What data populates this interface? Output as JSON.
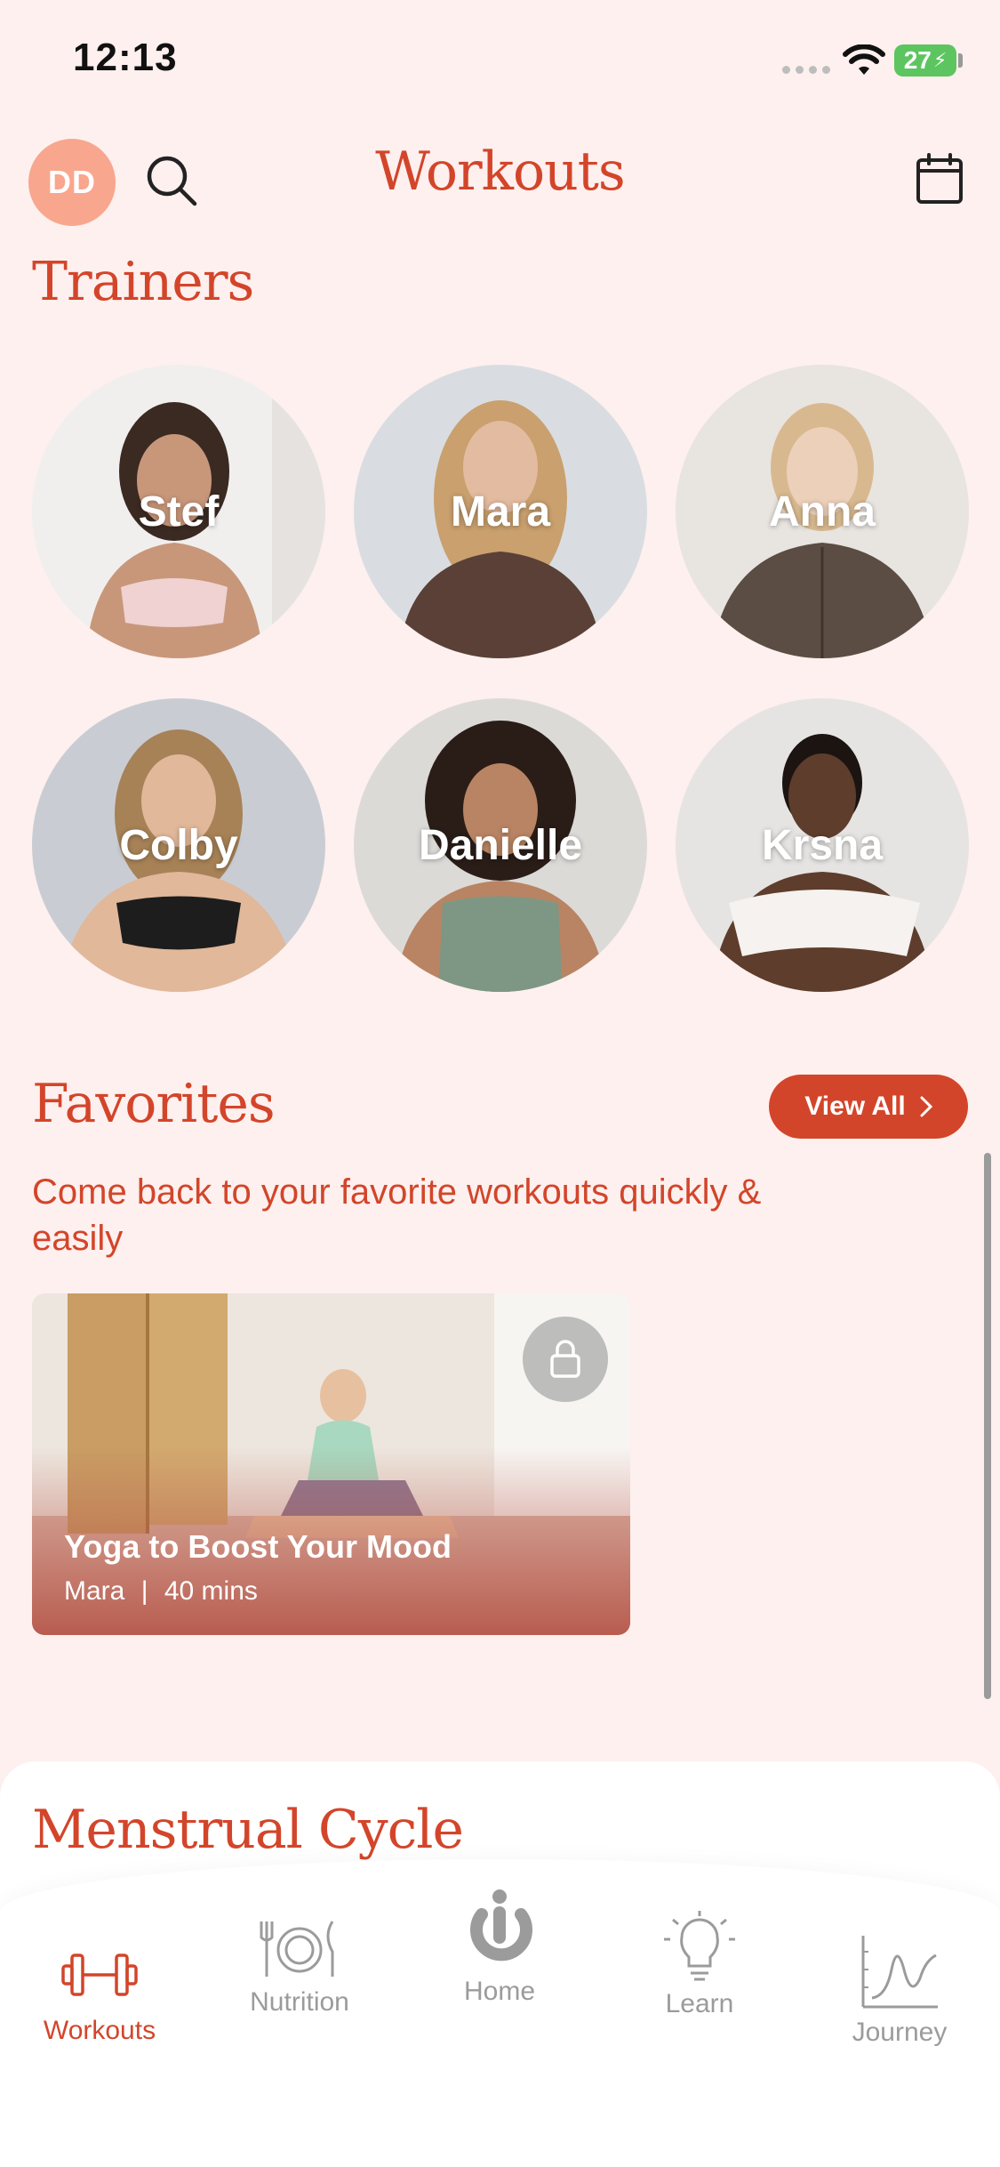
{
  "status_bar": {
    "time": "12:13",
    "battery": "27"
  },
  "header": {
    "avatar_initials": "DD",
    "title": "Workouts"
  },
  "trainers": {
    "title": "Trainers",
    "items": [
      {
        "name": "Stef"
      },
      {
        "name": "Mara"
      },
      {
        "name": "Anna"
      },
      {
        "name": "Colby"
      },
      {
        "name": "Danielle"
      },
      {
        "name": "Krsna"
      }
    ]
  },
  "favorites": {
    "title": "Favorites",
    "view_all": "View All",
    "subtitle": "Come back to your favorite workouts quickly & easily",
    "card": {
      "title": "Yoga to Boost Your Mood",
      "trainer": "Mara",
      "separator": "|",
      "duration": "40 mins"
    }
  },
  "menstrual": {
    "title": "Menstrual Cycle"
  },
  "tab_bar": {
    "items": [
      {
        "label": "Workouts",
        "icon": "dumbbell-icon",
        "active": true
      },
      {
        "label": "Nutrition",
        "icon": "plate-cutlery-icon",
        "active": false
      },
      {
        "label": "Home",
        "icon": "home-logo-icon",
        "active": false
      },
      {
        "label": "Learn",
        "icon": "lightbulb-icon",
        "active": false
      },
      {
        "label": "Journey",
        "icon": "chart-line-icon",
        "active": false
      }
    ]
  },
  "colors": {
    "accent": "#d3452a",
    "background": "#fdf0ee",
    "avatar": "#f8a68d",
    "inactive": "#9b9b9b"
  }
}
